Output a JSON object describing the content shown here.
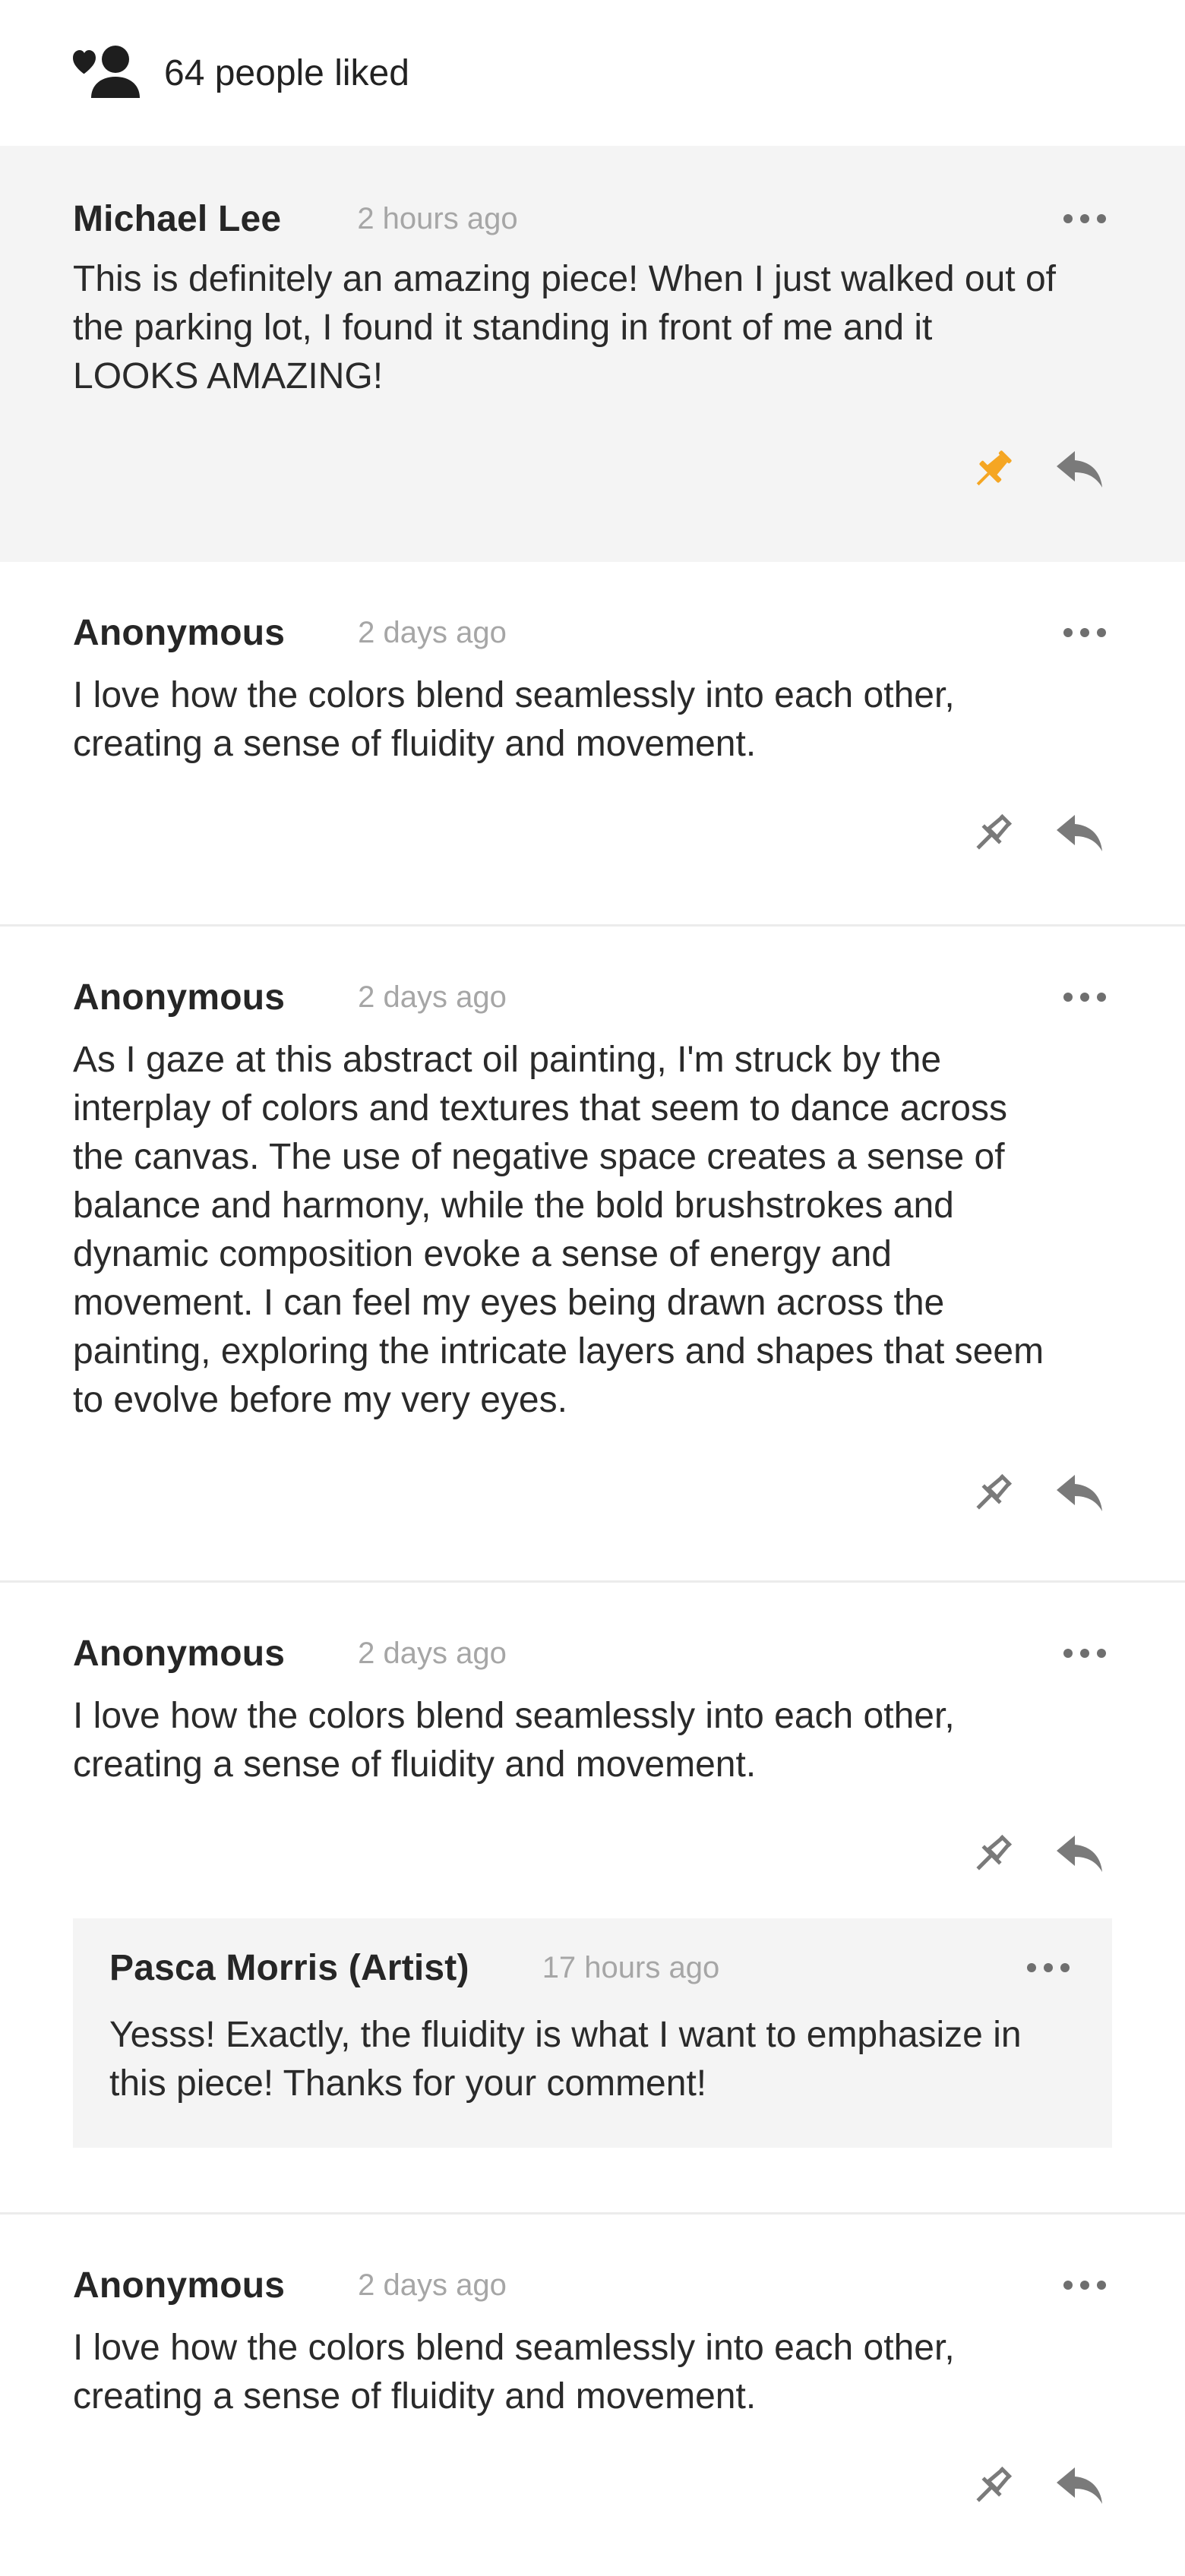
{
  "likes": {
    "text": "64 people liked",
    "icon": "person-heart-icon"
  },
  "colors": {
    "pin_active": "#f5a623",
    "icon_gray": "#7a7a7a",
    "highlight_bg": "#f4f4f4"
  },
  "comments": [
    {
      "author": "Michael Lee",
      "time": "2 hours ago",
      "body": "This is definitely an amazing piece! When I just walked out of the parking lot, I found it standing in front of me and it LOOKS AMAZING!",
      "pinned": true
    },
    {
      "author": "Anonymous",
      "time": "2 days ago",
      "body": "I love how the colors blend seamlessly into each other, creating a sense of fluidity and movement.",
      "pinned": false
    },
    {
      "author": "Anonymous",
      "time": "2 days ago",
      "body": "As I gaze at this abstract oil painting, I'm struck by the interplay of colors and textures that seem to dance across the canvas. The use of negative space creates a sense of balance and harmony, while the bold brushstrokes and dynamic composition evoke a sense of energy and movement. I can feel my eyes being drawn across the painting, exploring the intricate layers and shapes that seem to evolve before my very eyes.",
      "pinned": false
    },
    {
      "author": "Anonymous",
      "time": "2 days ago",
      "body": "I love how the colors blend seamlessly into each other, creating a sense of fluidity and movement.",
      "pinned": false,
      "reply": {
        "author": "Pasca Morris (Artist)",
        "time": "17 hours ago",
        "body": "Yesss! Exactly, the fluidity is what I want to emphasize in this piece! Thanks for your comment!"
      }
    },
    {
      "author": "Anonymous",
      "time": "2 days ago",
      "body": "I love how the colors blend seamlessly into each other, creating a sense of fluidity and movement.",
      "pinned": false
    }
  ]
}
